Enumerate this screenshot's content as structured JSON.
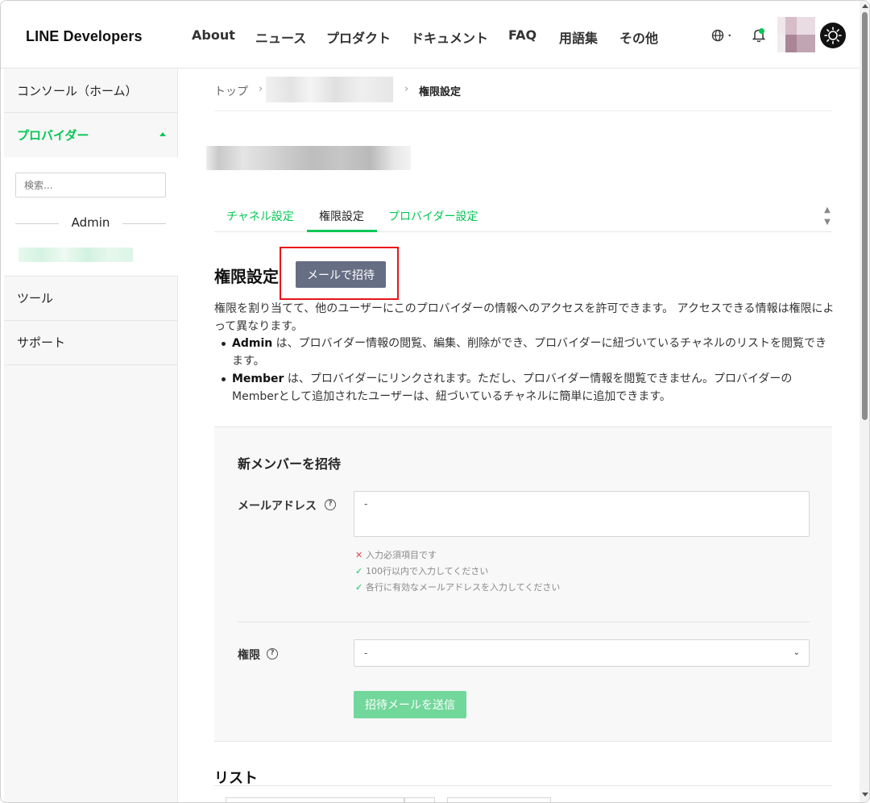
{
  "header": {
    "logo": "LINE Developers",
    "nav": [
      "About",
      "ニュース",
      "プロダクト",
      "ドキュメント",
      "FAQ",
      "用語集",
      "その他"
    ]
  },
  "sidebar": {
    "console_home": "コンソール（ホーム）",
    "provider": "プロバイダー",
    "search_placeholder": "検索...",
    "admin_label": "Admin",
    "tools": "ツール",
    "support": "サポート"
  },
  "breadcrumb": {
    "top": "トップ",
    "separator": "›",
    "current": "権限設定"
  },
  "tabs": [
    {
      "label": "チャネル設定",
      "active": false
    },
    {
      "label": "権限設定",
      "active": true
    },
    {
      "label": "プロバイダー設定",
      "active": false
    }
  ],
  "section": {
    "title": "権限設定",
    "invite_button": "メールで招待",
    "description": "権限を割り当てて、他のユーザーにこのプロバイダーの情報へのアクセスを許可できます。 アクセスできる情報は権限によって異なります。",
    "bullets": [
      {
        "role": "Admin",
        "text": " は、プロバイダー情報の閲覧、編集、削除ができ、プロバイダーに紐づいているチャネルのリストを閲覧できます。"
      },
      {
        "role": "Member",
        "text": " は、プロバイダーにリンクされます。ただし、プロバイダー情報を閲覧できません。プロバイダーのMemberとして追加されたユーザーは、紐づいているチャネルに簡単に追加できます。"
      }
    ]
  },
  "form": {
    "title": "新メンバーを招待",
    "email_label": "メールアドレス",
    "email_placeholder": "-",
    "hints": [
      {
        "status": "error",
        "mark": "✕",
        "text": "入力必須項目です"
      },
      {
        "status": "ok",
        "mark": "✓",
        "text": "100行以内で入力してください"
      },
      {
        "status": "ok",
        "mark": "✓",
        "text": "各行に有効なメールアドレスを入力してください"
      }
    ],
    "role_label": "権限",
    "role_selected": "-",
    "submit_button": "招待メールを送信"
  },
  "list": {
    "title": "リスト"
  },
  "colors": {
    "accent": "#06c755",
    "button_dark": "#666e84",
    "button_disabled": "#72d79b",
    "highlight": "#e8141a"
  }
}
